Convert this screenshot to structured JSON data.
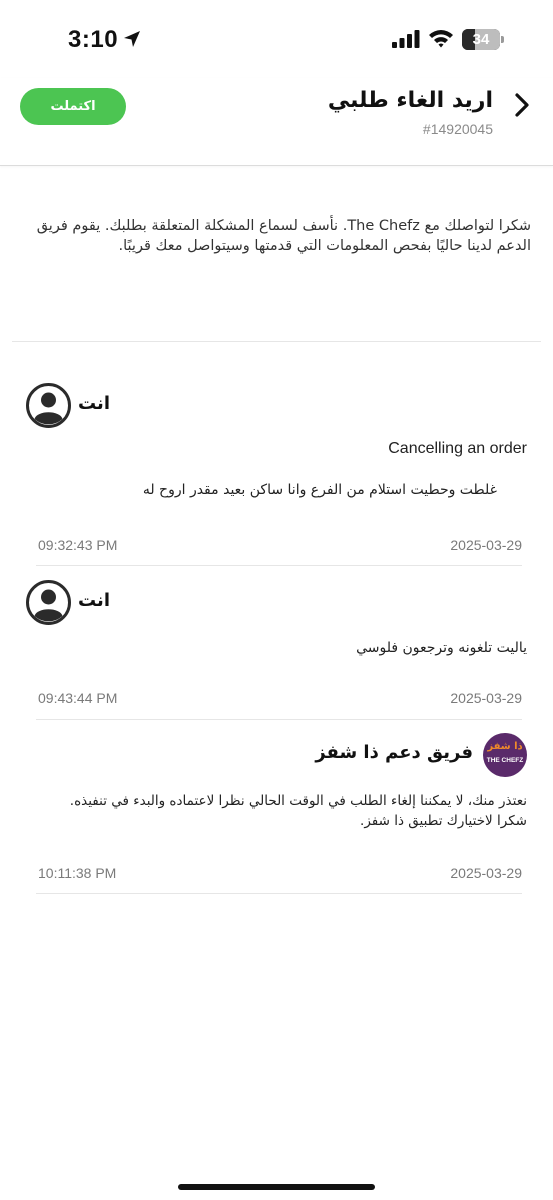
{
  "status_bar": {
    "time": "3:10",
    "battery": "34",
    "battery_level": 0.34
  },
  "header": {
    "title": "اريد الغاء طلبي",
    "ticket_id": "#14920045",
    "status_label": "اكتملت",
    "status_color": "#4cc552"
  },
  "intro": {
    "text": "شكرا لتواصلك مع The Chefz. نأسف لسماع المشكلة المتعلقة بطلبك. يقوم فريق الدعم لدينا حاليًا بفحص المعلومات التي قدمتها وسيتواصل معك قريبًا."
  },
  "messages": [
    {
      "sender": "انت",
      "title": "Cancelling an order",
      "text": "غلطت وحطيت استلام من الفرع وانا ساكن بعيد مقدر اروح له",
      "time": "09:32:43 PM",
      "date": "2025-03-29"
    },
    {
      "sender": "انت",
      "text": "ياليت تلغونه وترجعون فلوسي",
      "time": "09:43:44 PM",
      "date": "2025-03-29"
    },
    {
      "sender": "فريق دعم ذا شفز",
      "logo_ar": "ذا شفز",
      "logo_en": "THE CHEFZ",
      "text_line1": "نعتذر منك، لا يمكننا إلغاء الطلب في الوقت الحالي نظرا لاعتماده والبدء في تنفيذه.",
      "text_line2": "شكرا لاختيارك تطبيق ذا شفز.",
      "time": "10:11:38 PM",
      "date": "2025-03-29"
    }
  ]
}
